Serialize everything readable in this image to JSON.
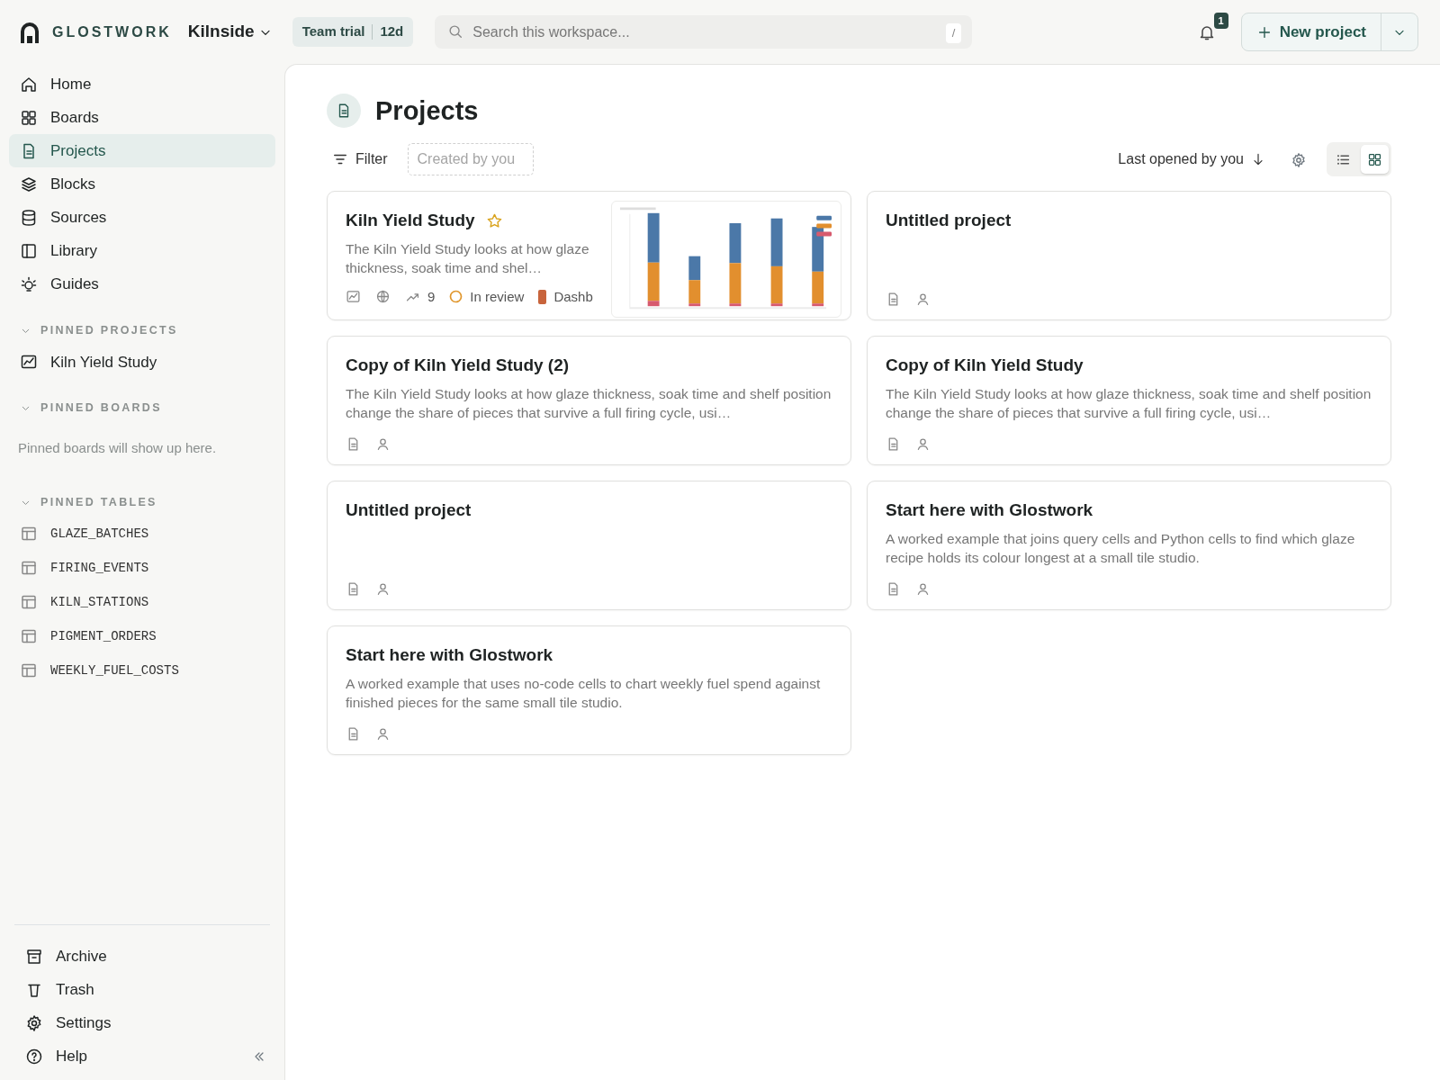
{
  "brand": {
    "name": "GLOSTWORK"
  },
  "workspace": {
    "name": "Kilnside"
  },
  "trial": {
    "label": "Team trial",
    "days": "12d"
  },
  "search": {
    "placeholder": "Search this workspace...",
    "shortcut": "/"
  },
  "notifications": {
    "count": "1"
  },
  "new_button": {
    "label": "New project"
  },
  "sidebar": {
    "nav": [
      {
        "label": "Home",
        "selected": false
      },
      {
        "label": "Boards",
        "selected": false
      },
      {
        "label": "Projects",
        "selected": true
      },
      {
        "label": "Blocks",
        "selected": false
      },
      {
        "label": "Sources",
        "selected": false
      },
      {
        "label": "Library",
        "selected": false
      },
      {
        "label": "Guides",
        "selected": false
      }
    ],
    "sections": [
      {
        "title": "PINNED PROJECTS",
        "expanded": true,
        "kind": "projects",
        "items": [
          "Kiln Yield Study"
        ]
      },
      {
        "title": "PINNED BOARDS",
        "expanded": true,
        "kind": "empty",
        "empty_text": "Pinned boards will show up here."
      },
      {
        "title": "PINNED TABLES",
        "expanded": true,
        "kind": "tables",
        "items": [
          "GLAZE_BATCHES",
          "FIRING_EVENTS",
          "KILN_STATIONS",
          "PIGMENT_ORDERS",
          "WEEKLY_FUEL_COSTS"
        ]
      }
    ],
    "footer": [
      "Archive",
      "Trash",
      "Settings",
      "Help"
    ]
  },
  "page": {
    "title": "Projects",
    "filter": "Filter",
    "filter_chip": {
      "placeholder": "Created by you"
    },
    "sort": "Last opened by you",
    "views": [
      {
        "kind": "list",
        "selected": false
      },
      {
        "kind": "grid",
        "selected": true
      }
    ]
  },
  "projects": [
    {
      "kind": "featured",
      "title": "Kiln Yield Study",
      "starred": true,
      "description": "The Kiln Yield Study looks at how glaze thickness, soak time and shel…",
      "views": "9",
      "status": "In review",
      "tag": "Dashb"
    },
    {
      "kind": "plain",
      "title": "Untitled project",
      "starred": false
    },
    {
      "kind": "plain",
      "title": "Copy of Kiln Yield Study (2)",
      "starred": false,
      "description": "The Kiln Yield Study looks at how glaze thickness, soak time and shelf position change the share of pieces that survive a full firing cycle, usi…"
    },
    {
      "kind": "plain",
      "title": "Copy of Kiln Yield Study",
      "starred": false,
      "description": "The Kiln Yield Study looks at how glaze thickness, soak time and shelf position change the share of pieces that survive a full firing cycle, usi…"
    },
    {
      "kind": "plain",
      "title": "Untitled project",
      "starred": false
    },
    {
      "kind": "plain",
      "title": "Start here with Glostwork",
      "starred": false,
      "description": "A worked example that joins query cells and Python cells to find which glaze recipe holds its colour longest at a small tile studio."
    },
    {
      "kind": "plain",
      "title": "Start here with Glostwork",
      "starred": false,
      "description": "A worked example that uses no-code cells to chart weekly fuel spend against finished pieces for the same small tile studio."
    }
  ]
}
